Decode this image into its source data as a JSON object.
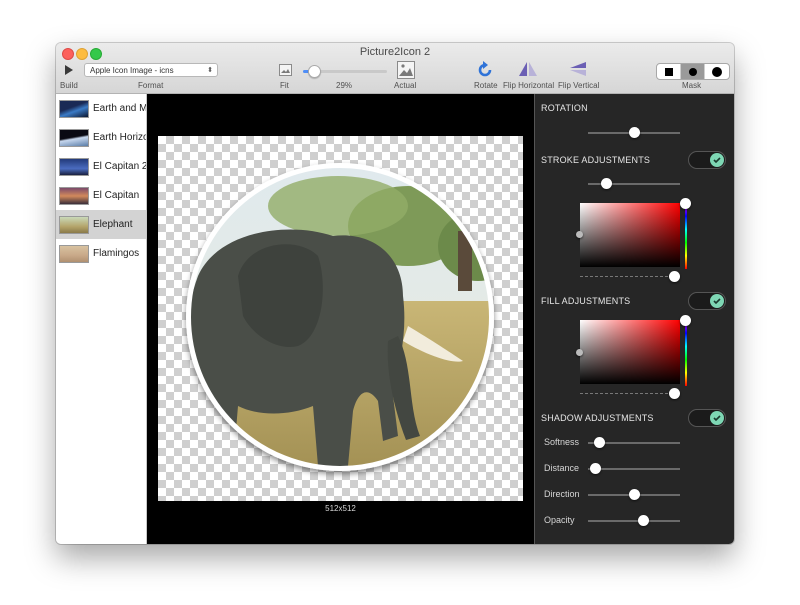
{
  "window": {
    "title": "Picture2Icon 2"
  },
  "toolbar": {
    "build_label": "Build",
    "format_label": "Format",
    "format_value": "Apple Icon Image - icns",
    "fit_label": "Fit",
    "zoom_value": "29%",
    "zoom_fraction": 0.29,
    "actual_label": "Actual",
    "rotate_label": "Rotate",
    "flip_h_label": "Flip Horizontal",
    "flip_v_label": "Flip Vertical",
    "mask_label": "Mask",
    "mask_options": [
      "square",
      "circle",
      "circle-outline"
    ],
    "mask_selected": "circle"
  },
  "sidebar": {
    "items": [
      {
        "label": "Earth and M",
        "selected": false
      },
      {
        "label": "Earth Horizo",
        "selected": false
      },
      {
        "label": "El Capitan 2",
        "selected": false
      },
      {
        "label": "El Capitan",
        "selected": false
      },
      {
        "label": "Elephant",
        "selected": true
      },
      {
        "label": "Flamingos",
        "selected": false
      }
    ]
  },
  "canvas": {
    "size_label": "512x512"
  },
  "panel": {
    "rotation": {
      "title": "ROTATION",
      "value": 0.5
    },
    "stroke": {
      "title": "STROKE ADJUSTMENTS",
      "enabled": true,
      "width": 0.2
    },
    "fill": {
      "title": "FILL ADJUSTMENTS",
      "enabled": true
    },
    "shadow": {
      "title": "SHADOW ADJUSTMENTS",
      "enabled": true,
      "softness_label": "Softness",
      "softness": 0.12,
      "distance_label": "Distance",
      "distance": 0.08,
      "direction_label": "Direction",
      "direction": 0.5,
      "opacity_label": "Opacity",
      "opacity": 0.6
    }
  },
  "colors": {
    "toggle_on": "#7ed7b4",
    "accent": "#4f8ef7",
    "panel_bg": "#262626"
  }
}
